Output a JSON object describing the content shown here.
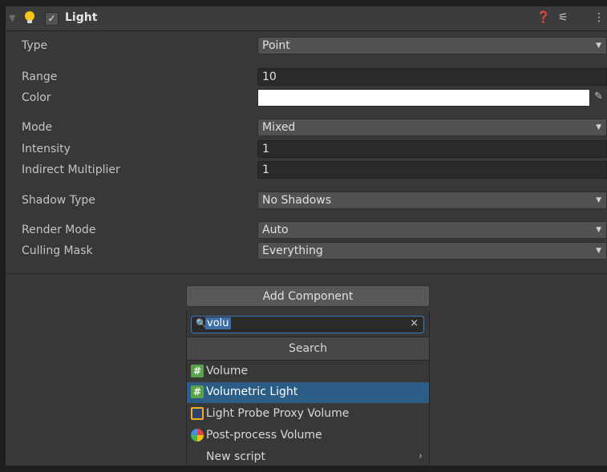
{
  "component": {
    "title": "Light",
    "enabled_check": "✓",
    "help_icon": "❓",
    "presets_icon": "⚟",
    "menu_icon": "⋮"
  },
  "properties": {
    "type": {
      "label": "Type",
      "value": "Point"
    },
    "range": {
      "label": "Range",
      "value": "10"
    },
    "color": {
      "label": "Color",
      "value": "#ffffff"
    },
    "mode": {
      "label": "Mode",
      "value": "Mixed"
    },
    "intensity": {
      "label": "Intensity",
      "value": "1"
    },
    "indirect": {
      "label": "Indirect Multiplier",
      "value": "1"
    },
    "shadow": {
      "label": "Shadow Type",
      "value": "No Shadows"
    },
    "render_mode": {
      "label": "Render Mode",
      "value": "Auto"
    },
    "culling": {
      "label": "Culling Mask",
      "value": "Everything"
    }
  },
  "add_component": {
    "button_label": "Add Component",
    "search_query": "volu",
    "clear_icon": "×",
    "search_header": "Search",
    "items": [
      {
        "label": "Volume",
        "icon": "script-icon"
      },
      {
        "label": "Volumetric Light",
        "icon": "script-icon"
      },
      {
        "label": "Light Probe Proxy Volume",
        "icon": "light-probe-proxy-icon"
      },
      {
        "label": "Post-process Volume",
        "icon": "post-process-icon"
      },
      {
        "label": "New script",
        "icon": "chevron-right-icon"
      }
    ],
    "selected_index": 1
  },
  "colors": {
    "selection": "#2c5d87",
    "search_focus": "#3a79bb",
    "script_icon": "#5aa34b",
    "bulb": "#f5c518"
  }
}
